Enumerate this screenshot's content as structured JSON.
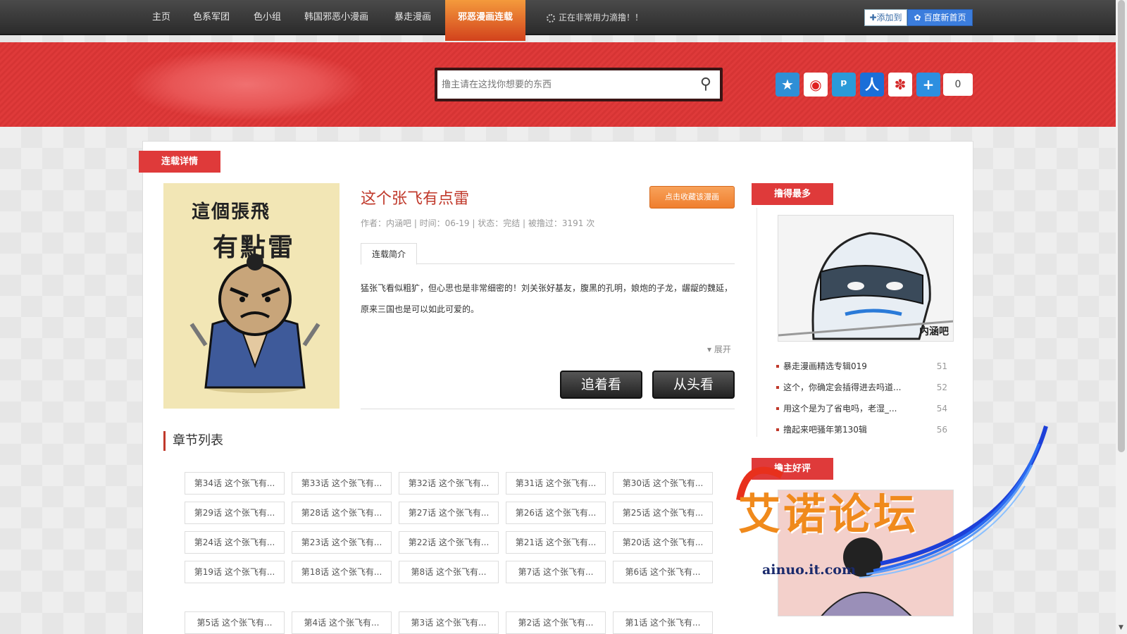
{
  "nav": {
    "items": [
      "主页",
      "色系军团",
      "色小组",
      "韩国邪恶小漫画",
      "暴走漫画",
      "邪恶漫画连载"
    ],
    "status_text": "正在非常用力滴撸！！",
    "add_label": "添加到",
    "baidu_label": "百度新首页"
  },
  "header": {
    "search_placeholder": "撸主请在这找你想要的东西",
    "share_icons": [
      "qzone-icon",
      "weibo-icon",
      "tencent-weibo-icon",
      "renren-icon",
      "netease-icon",
      "more-share-icon"
    ],
    "share_count": "0"
  },
  "detail": {
    "section_tag": "连载详情",
    "cover_title_1": "這個張飛",
    "cover_title_2": "有點雷",
    "title": "这个张飞有点雷",
    "fav_button": "点击收藏该漫画",
    "meta": "作者：内涵吧 | 时间：06-19 | 状态：完结 | 被撸过：3191 次",
    "tab_label": "连载简介",
    "description": "猛张飞看似粗犷，但心思也是非常细密的！刘关张好基友，腹黑的孔明，娘炮的子龙，龌龊的魏延，原来三国也是可以如此可爱的。",
    "expand_label": "展开",
    "follow_button": "追着看",
    "start_button": "从头看"
  },
  "chapters": {
    "heading": "章节列表",
    "items": [
      "第34话 这个张飞有...",
      "第33话 这个张飞有...",
      "第32话 这个张飞有...",
      "第31话 这个张飞有...",
      "第30话 这个张飞有...",
      "第29话 这个张飞有...",
      "第28话 这个张飞有...",
      "第27话 这个张飞有...",
      "第26话 这个张飞有...",
      "第25话 这个张飞有...",
      "第24话 这个张飞有...",
      "第23话 这个张飞有...",
      "第22话 这个张飞有...",
      "第21话 这个张飞有...",
      "第20话 这个张飞有...",
      "第19话 这个张飞有...",
      "第18话 这个张飞有...",
      "第8话 这个张飞有...",
      "第7话 这个张飞有...",
      "第6话 这个张飞有...",
      "第5话 这个张飞有...",
      "第4话 这个张飞有...",
      "第3话 这个张飞有...",
      "第2话 这个张飞有...",
      "第1话 这个张飞有..."
    ]
  },
  "sidebar": {
    "top_tag": "撸得最多",
    "image_caption": "内涵吧",
    "list": [
      {
        "title": "暴走漫画精选专辑019",
        "count": "51"
      },
      {
        "title": "这个，你确定会插得进去吗道...",
        "count": "52"
      },
      {
        "title": "用这个是为了省电吗，老湿_...",
        "count": "54"
      },
      {
        "title": "撸起来吧骚年第130辑",
        "count": "56"
      }
    ],
    "rated_tag": "撸主好评"
  },
  "watermark": {
    "text": "艾诺论坛",
    "url": "ainuo.it.com"
  },
  "colors": {
    "brand_red": "#df3a3a",
    "nav_dark": "#2b2b2b",
    "active_orange": "#f49a3c",
    "title_red": "#c0392b"
  }
}
